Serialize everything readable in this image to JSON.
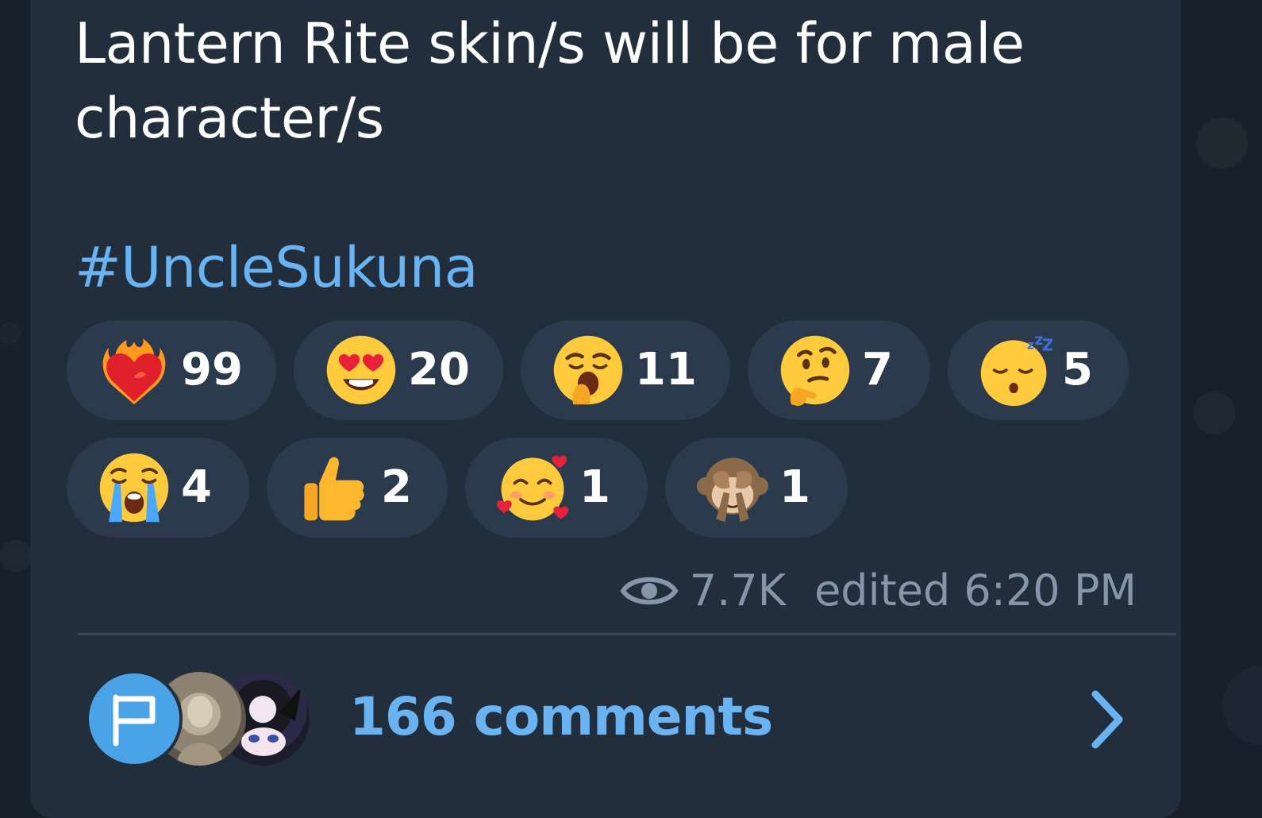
{
  "message": {
    "line1": "Lantern Rite skin/s will be for male",
    "line2": "character/s",
    "hashtag": "#UncleSukuna"
  },
  "reactions": [
    {
      "emoji": "heart-on-fire",
      "count": "99"
    },
    {
      "emoji": "heart-eyes",
      "count": "20"
    },
    {
      "emoji": "yawning-face",
      "count": "11"
    },
    {
      "emoji": "thinking-face",
      "count": "7"
    },
    {
      "emoji": "sleeping-face",
      "count": "5"
    },
    {
      "emoji": "crying-face",
      "count": "4"
    },
    {
      "emoji": "thumbs-up",
      "count": "2"
    },
    {
      "emoji": "smiling-face-with-hearts",
      "count": "1"
    },
    {
      "emoji": "see-no-evil-monkey",
      "count": "1"
    }
  ],
  "meta": {
    "views": "7.7K",
    "edited": "edited 6:20 PM"
  },
  "comments": {
    "label": "166 comments"
  },
  "colors": {
    "background": "#17212b",
    "bubble": "#222e3c",
    "reaction_pill": "#2b3a4c",
    "link": "#6ab3f3",
    "meta": "#8696a8"
  }
}
